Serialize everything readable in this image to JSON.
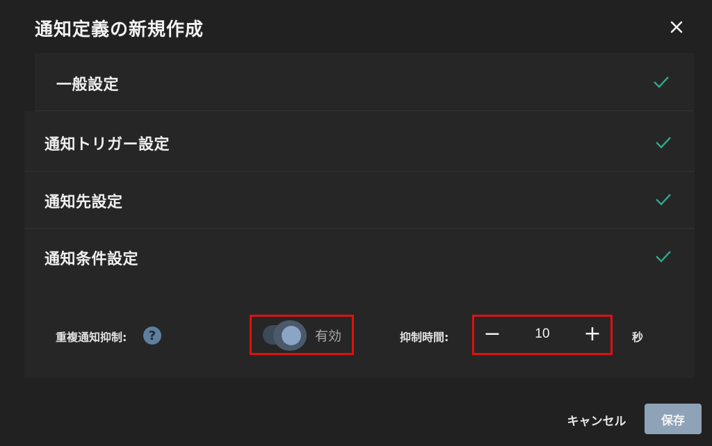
{
  "dialog": {
    "title": "通知定義の新規作成",
    "close_icon": "close-icon"
  },
  "sections": [
    {
      "label": "一般設定",
      "completed": true
    },
    {
      "label": "通知トリガー設定",
      "completed": true
    },
    {
      "label": "通知先設定",
      "completed": true
    },
    {
      "label": "通知条件設定",
      "completed": true
    }
  ],
  "condition": {
    "duplicate_label": "重複通知抑制:",
    "help_glyph": "?",
    "toggle_on": true,
    "toggle_label": "有効",
    "suppress_label": "抑制時間:",
    "minus_glyph": "−",
    "plus_glyph": "+",
    "suppress_value": "10",
    "unit": "秒"
  },
  "footer": {
    "cancel_label": "キャンセル",
    "save_label": "保存"
  },
  "colors": {
    "check": "#2fa88e",
    "highlight": "#e01010",
    "save_bg": "#8ea3b7"
  }
}
